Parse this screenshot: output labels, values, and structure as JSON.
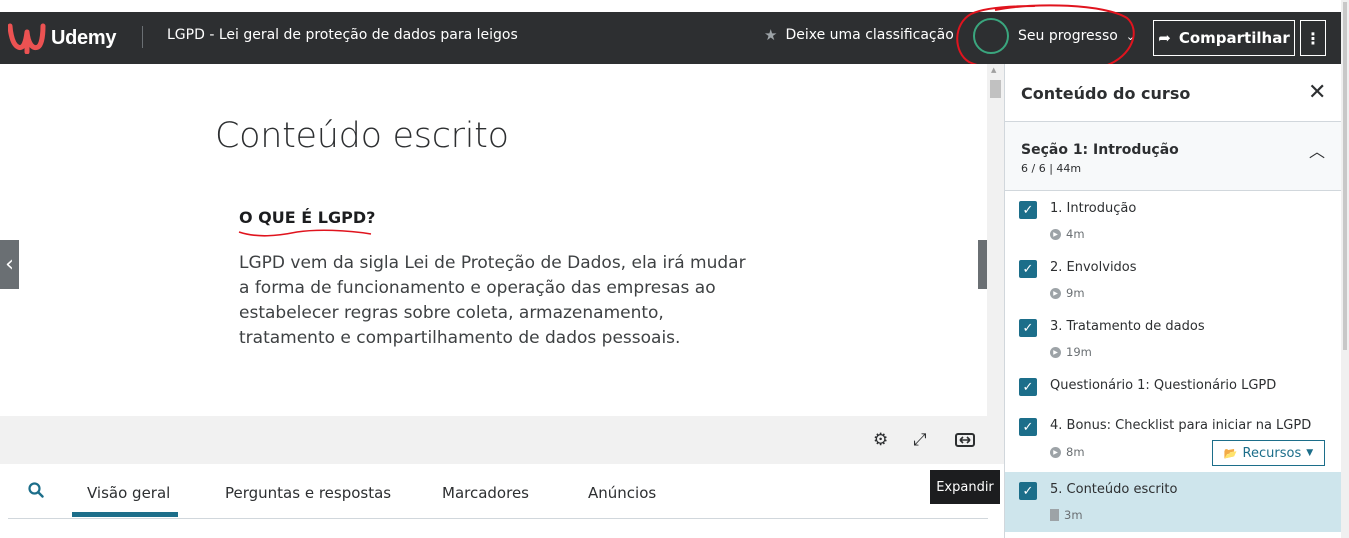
{
  "header": {
    "brand": "Udemy",
    "course_title": "LGPD - Lei geral de proteção de dados para leigos",
    "rate_label": "Deixe uma classificação",
    "progress_label": "Seu progresso",
    "share_label": "Compartilhar",
    "more_label": "⋮",
    "brand_color": "#a435f0",
    "logo_color": "#ec5252"
  },
  "content": {
    "title": "Conteúdo escrito",
    "subheading": "O QUE É LGPD?",
    "body": "LGPD vem da sigla Lei de Proteção de Dados, ela irá mudar a forma de funcionamento e operação das empresas ao estabelecer regras sobre coleta, armazenamento, tratamento e compartilhamento de dados pessoais."
  },
  "controls": {
    "tooltip": "Expandir"
  },
  "tabs": [
    {
      "label": "Visão geral",
      "active": true
    },
    {
      "label": "Perguntas e respostas",
      "active": false
    },
    {
      "label": "Marcadores",
      "active": false
    },
    {
      "label": "Anúncios",
      "active": false
    }
  ],
  "sidebar": {
    "heading": "Conteúdo do curso",
    "section": {
      "title": "Seção 1: Introdução",
      "meta": "6 / 6 | 44m"
    },
    "lessons": [
      {
        "title": "1. Introdução",
        "meta": "4m",
        "kind": "video",
        "checked": true
      },
      {
        "title": "2. Envolvidos",
        "meta": "9m",
        "kind": "video",
        "checked": true
      },
      {
        "title": "3. Tratamento de dados",
        "meta": "19m",
        "kind": "video",
        "checked": true
      },
      {
        "title": "Questionário 1: Questionário LGPD",
        "meta": "",
        "kind": "quiz",
        "checked": true
      },
      {
        "title": "4. Bonus: Checklist para iniciar na LGPD",
        "meta": "8m",
        "kind": "video",
        "checked": true,
        "resources_label": "Recursos"
      },
      {
        "title": "5. Conteúdo escrito",
        "meta": "3m",
        "kind": "article",
        "checked": true,
        "current": true
      }
    ]
  },
  "colors": {
    "header_bg": "#2d2f31",
    "accent": "#1c6e8a",
    "progress_ring": "#3aa67e",
    "annotation": "#e0141e",
    "current_lesson_bg": "#cee5ec"
  }
}
